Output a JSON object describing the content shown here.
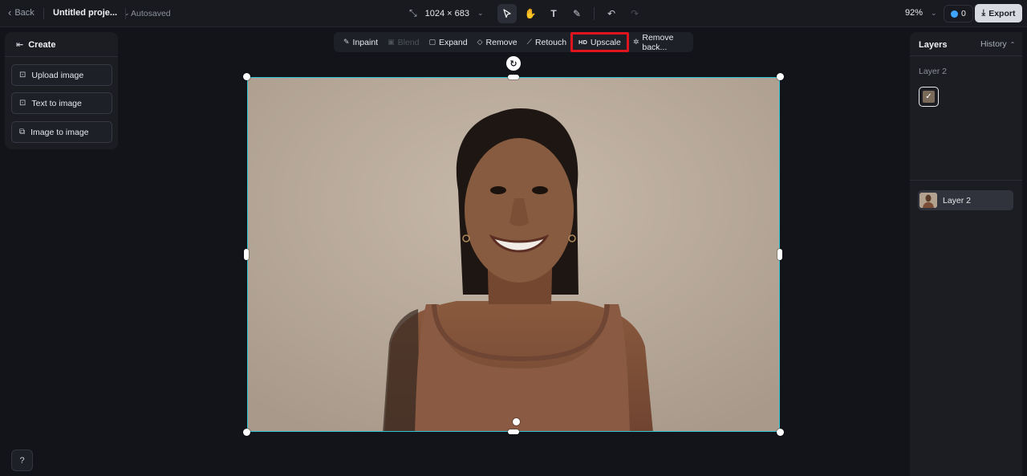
{
  "topbar": {
    "back_label": "Back",
    "project_title": "Untitled proje...",
    "autosave_status": "Autosaved",
    "canvas_size": "1024 × 683",
    "zoom": "92%",
    "credits": "0",
    "export_label": "Export"
  },
  "left_panel": {
    "header": "Create",
    "buttons": [
      {
        "label": "Upload image",
        "icon": "upload-image-icon"
      },
      {
        "label": "Text to image",
        "icon": "text-to-image-icon"
      },
      {
        "label": "Image to image",
        "icon": "image-to-image-icon"
      }
    ]
  },
  "edit_toolbar": {
    "items": [
      {
        "label": "Inpaint",
        "icon": "brush-icon",
        "enabled": true,
        "highlighted": false
      },
      {
        "label": "Blend",
        "icon": "blend-icon",
        "enabled": false,
        "highlighted": false
      },
      {
        "label": "Expand",
        "icon": "expand-icon",
        "enabled": true,
        "highlighted": false
      },
      {
        "label": "Remove",
        "icon": "eraser-icon",
        "enabled": true,
        "highlighted": false
      },
      {
        "label": "Retouch",
        "icon": "magic-wand-icon",
        "enabled": true,
        "highlighted": false
      },
      {
        "label": "Upscale",
        "icon_text": "HD",
        "enabled": true,
        "highlighted": true
      },
      {
        "label": "Remove back...",
        "icon": "remove-background-icon",
        "enabled": true,
        "highlighted": false
      }
    ],
    "highlight_color": "#e0141e"
  },
  "right_panel": {
    "tab_layers": "Layers",
    "tab_history": "History",
    "group_label": "Layer 2",
    "layer_row_label": "Layer 2"
  },
  "colors": {
    "background": "#121419",
    "selection": "#2ec4d6",
    "export_button": "#d7dbe1"
  }
}
